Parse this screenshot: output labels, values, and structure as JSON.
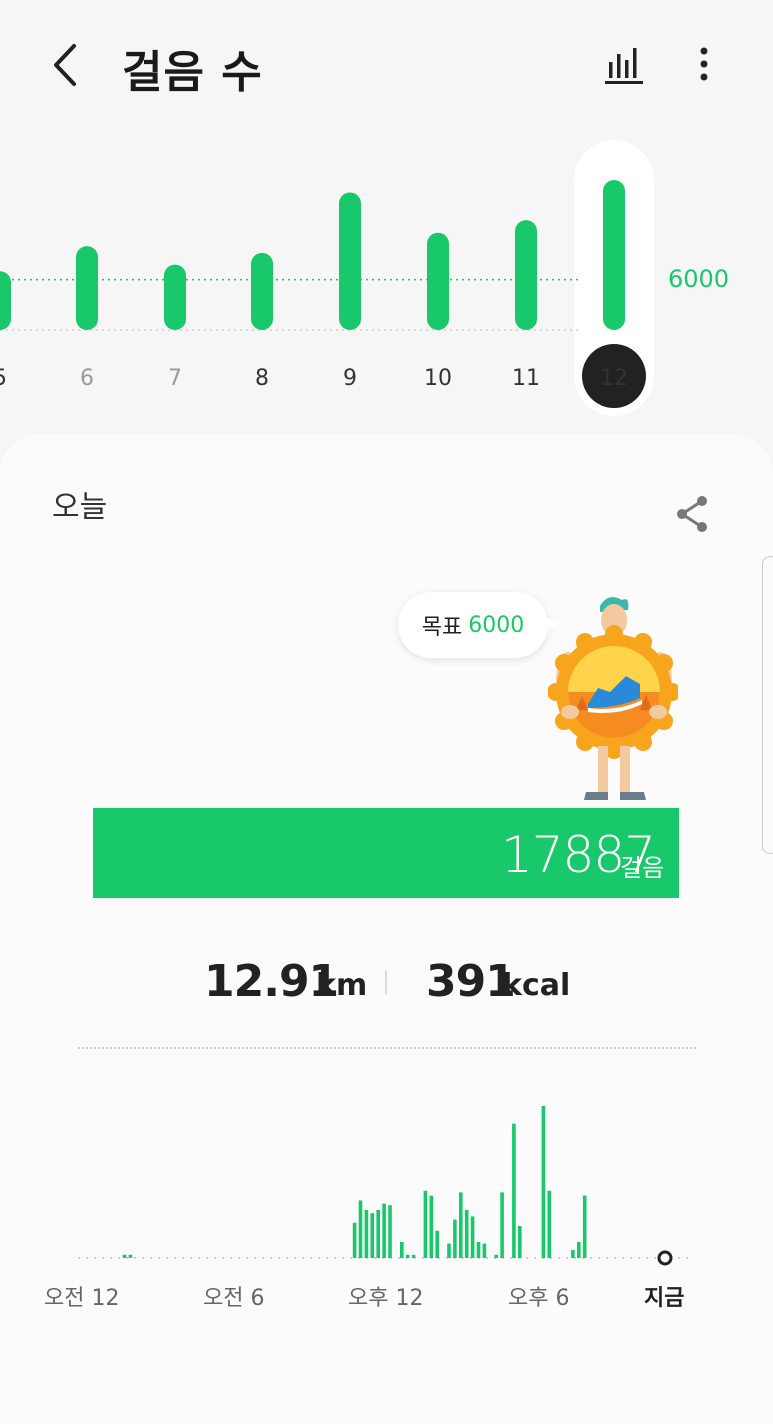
{
  "header": {
    "title": "걸음 수",
    "icons": {
      "back": "chevron-left-icon",
      "stats": "bar-chart-icon",
      "more": "more-vertical-icon"
    }
  },
  "daily": {
    "goal_label": "6000",
    "chart_data": {
      "type": "bar",
      "categories": [
        "5",
        "6",
        "7",
        "8",
        "9",
        "10",
        "11",
        "12"
      ],
      "values": [
        7000,
        10000,
        7800,
        9200,
        16400,
        11600,
        13100,
        17887
      ],
      "goal": 6000,
      "selected": "12",
      "muted": [
        "6",
        "7"
      ],
      "color": "#18c86b"
    }
  },
  "today": {
    "label": "오늘",
    "goal_label": "목표",
    "goal_value": "6000",
    "steps_value": "17887",
    "steps_unit": "걸음",
    "distance_value": "12.91",
    "distance_unit": "km",
    "calorie_value": "391",
    "calorie_unit": "kcal",
    "share_icon": "share-icon",
    "accent_color": "#18c86b"
  },
  "hourly": {
    "axis_labels": [
      "오전 12",
      "오전 6",
      "오후 12",
      "오후 6",
      "지금"
    ],
    "chart_data": {
      "type": "bar",
      "unit": "relative",
      "values": [
        0,
        0,
        0,
        2,
        2,
        0,
        0,
        0,
        0,
        0,
        0,
        0,
        0,
        0,
        0,
        0,
        0,
        0,
        0,
        0,
        0,
        0,
        0,
        0,
        0,
        0,
        0,
        0,
        0,
        0,
        0,
        0,
        0,
        0,
        0,
        0,
        0,
        0,
        0,
        0,
        0,
        0,
        22,
        36,
        30,
        28,
        30,
        34,
        33,
        0,
        10,
        2,
        2,
        0,
        42,
        39,
        17,
        0,
        9,
        24,
        41,
        30,
        26,
        10,
        9,
        0,
        2,
        41,
        0,
        84,
        20,
        0,
        0,
        0,
        95,
        42,
        0,
        0,
        0,
        5,
        10,
        39,
        0,
        0,
        0,
        0
      ],
      "color": "#18c86b"
    }
  }
}
